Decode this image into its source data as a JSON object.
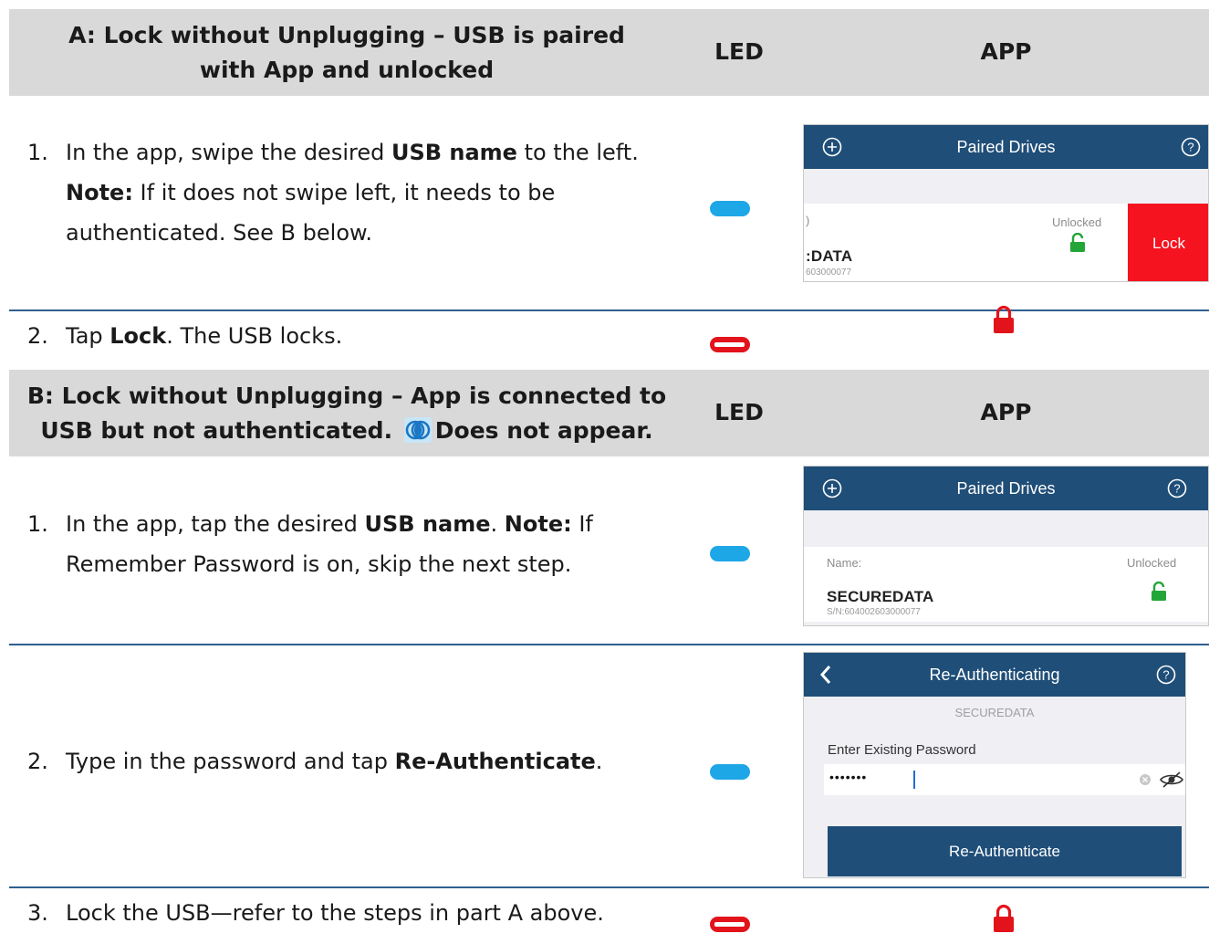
{
  "section_a": {
    "header": {
      "col1": "A: Lock without Unplugging – USB is paired with App and unlocked",
      "col2": "LED",
      "col3": "APP"
    },
    "steps": [
      {
        "num": "1.",
        "parts": [
          "In the app, swipe the desired ",
          "USB name",
          " to the left. ",
          "Note:",
          " If it does not swipe left, it needs to be authenticated. See B below."
        ]
      },
      {
        "num": "2.",
        "parts": [
          "Tap ",
          "Lock",
          ". The USB locks."
        ]
      }
    ],
    "app1": {
      "title": "Paired Drives",
      "left_glyph": ")",
      "status": "Unlocked",
      "drive": ":DATA",
      "serial": "603000077",
      "action": "Lock"
    }
  },
  "section_b": {
    "header": {
      "col1a": "B: Lock without Unplugging – App is connected to",
      "col1b": "USB but not authenticated.",
      "col1c": "Does not appear.",
      "col2": "LED",
      "col3": "APP"
    },
    "steps": [
      {
        "num": "1.",
        "parts": [
          "In the app, tap the desired ",
          "USB name",
          ". ",
          "Note:",
          " If Remember Password is on, skip the next step."
        ]
      },
      {
        "num": "2.",
        "parts": [
          "Type in the password and tap ",
          "Re-Authenticate",
          "."
        ]
      },
      {
        "num": "3.",
        "parts": [
          "Lock the USB—refer to the steps in part A above."
        ]
      }
    ],
    "app2": {
      "title": "Paired Drives",
      "name_label": "Name:",
      "status": "Unlocked",
      "drive": "SECUREDATA",
      "serial": "S/N:604002603000077"
    },
    "app3": {
      "title": "Re-Authenticating",
      "subtitle": "SECUREDATA",
      "field_label": "Enter Existing Password",
      "password_mask": "•••••••",
      "button": "Re-Authenticate"
    }
  },
  "colors": {
    "header_bg": "#d9d9d9",
    "rule": "#2f5f8f",
    "app_bar": "#1f4e78",
    "led_blue": "#1ea7e6",
    "led_red": "#e3131b",
    "lock_red": "#e3131b",
    "lock_green": "#23a538"
  },
  "icons": [
    "plus-circle-icon",
    "help-circle-icon",
    "padlock-icon",
    "back-chevron-icon",
    "clear-icon",
    "eye-slash-icon",
    "authenticate-icon"
  ]
}
